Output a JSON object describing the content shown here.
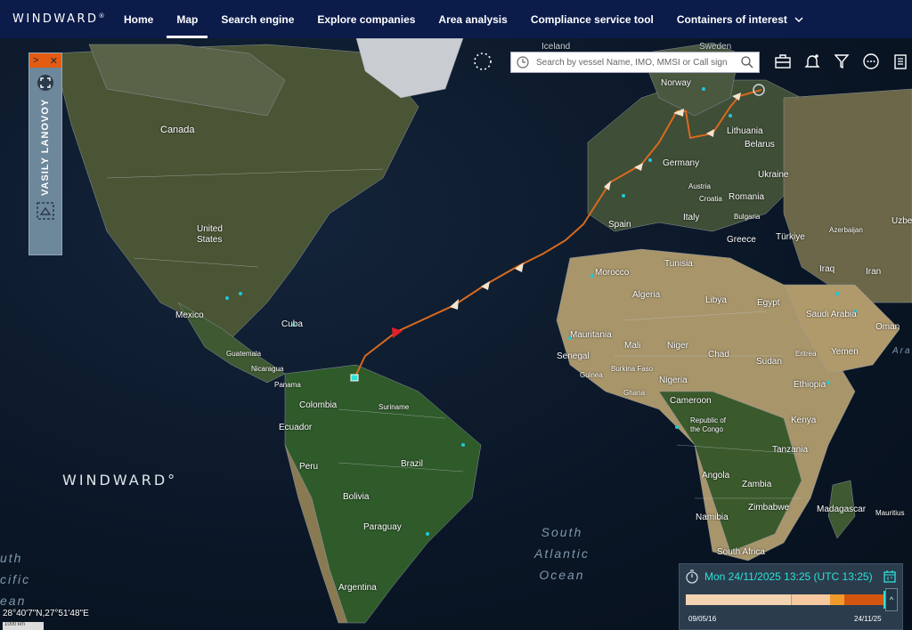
{
  "nav": {
    "brand": "WINDWARD",
    "items": [
      {
        "label": "Home"
      },
      {
        "label": "Map"
      },
      {
        "label": "Search engine"
      },
      {
        "label": "Explore companies"
      },
      {
        "label": "Area analysis"
      },
      {
        "label": "Compliance service tool"
      },
      {
        "label": "Containers of interest"
      }
    ]
  },
  "vessel_panel": {
    "name": "VASILY LANOVOY",
    "expand_glyph": ">",
    "close_glyph": "✕"
  },
  "search": {
    "placeholder": "Search by vessel Name, IMO, MMSI or Call sign"
  },
  "map_labels": {
    "iceland": "Iceland",
    "sweden": "Sweden",
    "norway": "Norway",
    "canada": "Canada",
    "lithuania": "Lithuania",
    "belarus": "Belarus",
    "germany": "Germany",
    "ukraine": "Ukraine",
    "austria": "Austria",
    "croatia": "Croatia",
    "romania": "Romania",
    "italy": "Italy",
    "bulgaria": "Bulgaria",
    "spain": "Spain",
    "greece": "Greece",
    "turkiye": "Türkiye",
    "azerbaijan": "Azerbaijan",
    "uzbek": "Uzbe",
    "united_states": "United\nStates",
    "tunisia": "Tunisia",
    "iraq": "Iraq",
    "iran": "Iran",
    "morocco": "Morocco",
    "algeria": "Algeria",
    "libya": "Libya",
    "egypt": "Egypt",
    "saudi": "Saudi Arabia",
    "oman": "Oman",
    "mexico": "Mexico",
    "cuba": "Cuba",
    "mauritania": "Mauritania",
    "mali": "Mali",
    "niger": "Niger",
    "chad": "Chad",
    "sudan": "Sudan",
    "eritrea": "Eritrea",
    "yemen": "Yemen",
    "guatemala": "Guatemala",
    "nicaragua": "Nicaragua",
    "senegal": "Senegal",
    "burkina": "Burkina Faso",
    "panama": "Panama",
    "guinea": "Guinea",
    "nigeria": "Nigeria",
    "ethiopia": "Ethiopia",
    "ghana": "Ghana",
    "colombia": "Colombia",
    "suriname": "Suriname",
    "cameroon": "Cameroon",
    "ecuador": "Ecuador",
    "congo": "Republic of\nthe Congo",
    "kenya": "Kenya",
    "peru": "Peru",
    "brazil": "Brazil",
    "tanzania": "Tanzania",
    "angola": "Angola",
    "zambia": "Zambia",
    "bolivia": "Bolivia",
    "zimbabwe": "Zimbabwe",
    "madagascar": "Madagascar",
    "mauritius": "Mauritius",
    "namibia": "Namibia",
    "paraguay": "Paraguay",
    "south_africa": "South Africa",
    "argentina": "Argentina",
    "south_atlantic": "South\nAtlantic\nOcean",
    "south_pacific": "uth\ncific\nean",
    "arabian": "Ara"
  },
  "watermark": "WINDWARD",
  "coordinates": "28°40'7\"N,27°51'48\"E",
  "scale": "1000 km",
  "timeline": {
    "datetime": "Mon 24/11/2025 13:25 (UTC 13:25)",
    "start_label": "09/05/16",
    "end_label": "24/11/25",
    "handle_glyph": "^"
  },
  "colors": {
    "nav_bg": "#0b1b4a",
    "accent_orange": "#e35c12",
    "route": "#d96a1f",
    "teal": "#2ee0d7"
  },
  "icons": [
    "spinner-icon",
    "clock-icon",
    "search-icon",
    "briefcase-icon",
    "bell-plus-icon",
    "filter-icon",
    "more-icon",
    "clipboard-icon",
    "fullscreen-icon",
    "vessel-photo-icon",
    "timer-icon",
    "calendar-icon"
  ]
}
